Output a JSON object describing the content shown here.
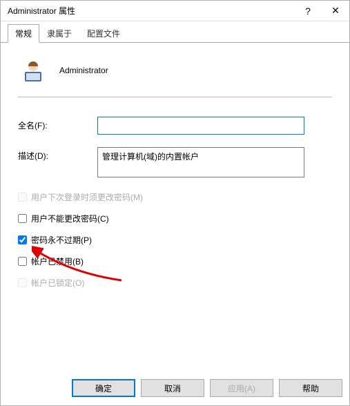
{
  "window": {
    "title": "Administrator 属性",
    "help": "?",
    "close": "✕"
  },
  "tabs": {
    "general": "常规",
    "memberOf": "隶属于",
    "profile": "配置文件"
  },
  "user": {
    "name": "Administrator"
  },
  "form": {
    "fullname_label": "全名(F):",
    "fullname_value": "",
    "description_label": "描述(D):",
    "description_value": "管理计算机(域)的内置帐户"
  },
  "checks": {
    "must_change": "用户下次登录时须更改密码(M)",
    "cannot_change": "用户不能更改密码(C)",
    "never_expires": "密码永不过期(P)",
    "disabled": "帐户已禁用(B)",
    "locked": "帐户已锁定(O)"
  },
  "buttons": {
    "ok": "确定",
    "cancel": "取消",
    "apply": "应用(A)",
    "help": "帮助"
  }
}
